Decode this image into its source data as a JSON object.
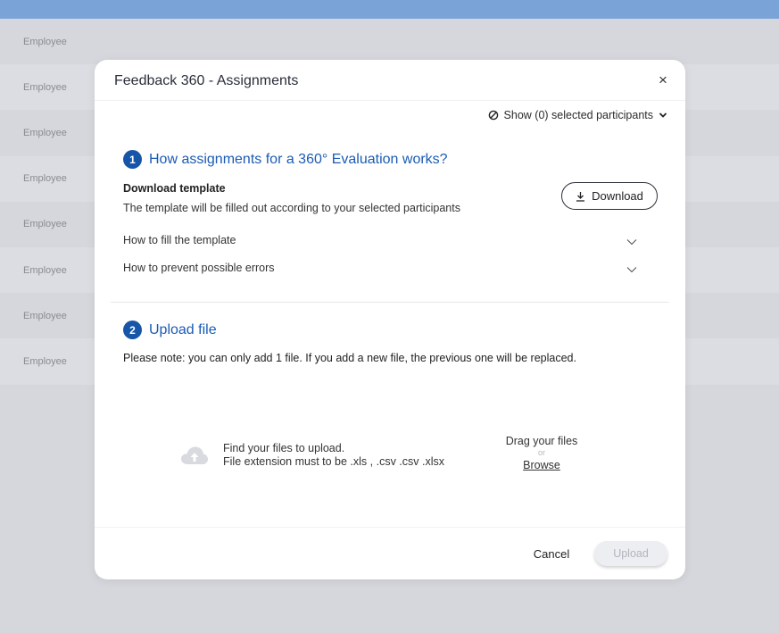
{
  "background": {
    "rows": [
      "Employee",
      "Employee",
      "Employee",
      "Employee",
      "Employee",
      "Employee",
      "Employee",
      "Employee"
    ]
  },
  "modal": {
    "title": "Feedback 360 - Assignments",
    "close_icon": "×",
    "show_selected": "Show (0) selected participants",
    "step1": {
      "number": "1",
      "title": "How assignments for a 360° Evaluation works?",
      "download_title": "Download template",
      "download_desc": "The template will be filled out according to your selected participants",
      "download_label": "Download",
      "accordion": [
        {
          "label": "How to fill the template"
        },
        {
          "label": "How to prevent possible errors"
        }
      ]
    },
    "step2": {
      "number": "2",
      "title": "Upload file",
      "note": "Please note: you can only add 1 file. If you add a new file, the previous one will be replaced.",
      "find_line1": "Find your files to upload.",
      "find_line2": "File extension must to be .xls , .csv .csv .xlsx",
      "drag_label": "Drag your files",
      "or_label": "or",
      "browse_label": "Browse"
    },
    "footer": {
      "cancel_label": "Cancel",
      "upload_label": "Upload"
    }
  },
  "colors": {
    "accent": "#1655a8",
    "topbar": "#7aa3d8"
  }
}
